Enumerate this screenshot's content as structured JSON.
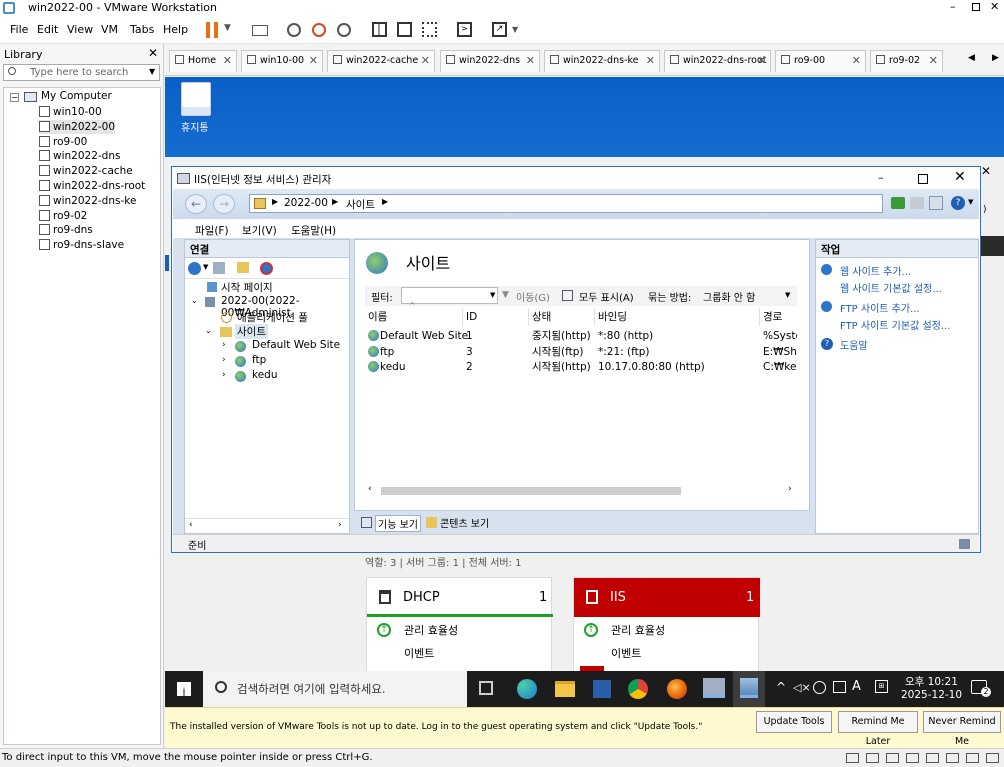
{
  "app": {
    "title": "win2022-00 - VMware Workstation"
  },
  "menu": [
    "File",
    "Edit",
    "View",
    "VM",
    "Tabs",
    "Help"
  ],
  "library": {
    "title": "Library",
    "search_placeholder": "Type here to search",
    "root": "My Computer",
    "items": [
      "win10-00",
      "win2022-00",
      "ro9-00",
      "win2022-dns",
      "win2022-cache",
      "win2022-dns-root",
      "win2022-dns-ke",
      "ro9-02",
      "ro9-dns",
      "ro9-dns-slave"
    ],
    "selected": 1
  },
  "tabs": [
    "Home",
    "win10-00",
    "win2022-cache",
    "win2022-dns",
    "win2022-dns-ke",
    "win2022-dns-root",
    "ro9-00",
    "ro9-02"
  ],
  "desktop": {
    "recycle_label": "휴지통"
  },
  "iis": {
    "title": "IIS(인터넷 정보 서비스) 관리자",
    "address": [
      "2022-00",
      "사이트"
    ],
    "menu": [
      "파일(F)",
      "보기(V)",
      "도움말(H)"
    ],
    "connections": {
      "title": "연결",
      "start": "시작 페이지",
      "server": "2022-00(2022-00₩Administ",
      "apppool": "애플리케이션 풀",
      "sites": "사이트",
      "children": [
        "Default Web Site",
        "ftp",
        "kedu"
      ]
    },
    "center": {
      "heading": "사이트",
      "filter_label": "필터:",
      "go_label": "이동(G)",
      "showall_label": "모두 표시(A)",
      "group_label": "묶는 방법:",
      "group_value": "그룹화 안 함",
      "columns": [
        "이름",
        "ID",
        "상태",
        "바인딩",
        "경로"
      ],
      "rows": [
        {
          "name": "Default Web Site",
          "id": "1",
          "status": "중지됨(http)",
          "binding": "*:80 (http)",
          "path": "%Syster"
        },
        {
          "name": "ftp",
          "id": "3",
          "status": "시작됨(ftp)",
          "binding": "*:21: (ftp)",
          "path": "E:₩Shar"
        },
        {
          "name": "kedu",
          "id": "2",
          "status": "시작됨(http)",
          "binding": "10.17.0.80:80 (http)",
          "path": "C:₩kedu"
        }
      ],
      "feature_view": "기능 보기",
      "content_view": "콘텐츠 보기"
    },
    "actions": {
      "title": "작업",
      "items": [
        "웹 사이트 추가...",
        "웹 사이트 기본값 설정...",
        "FTP 사이트 추가...",
        "FTP 사이트 기본값 설정...",
        "도움말"
      ]
    },
    "status": "준비"
  },
  "server_manager": {
    "summary": "역할: 3 | 서버 그룹: 1 | 전체 서버: 1",
    "cards": [
      {
        "name": "DHCP",
        "count": "1",
        "items": [
          "관리 효율성",
          "이벤트"
        ]
      },
      {
        "name": "IIS",
        "count": "1",
        "items": [
          "관리 효율성",
          "이벤트"
        ]
      }
    ]
  },
  "taskbar": {
    "search_placeholder": "검색하려면 여기에 입력하세요.",
    "time": "오후 10:21",
    "date": "2025-12-10",
    "notif": "2",
    "ime": "A"
  },
  "notice": {
    "text": "The installed version of VMware Tools is not up to date. Log in to the guest operating system and click \"Update Tools.\"",
    "buttons": [
      "Update Tools",
      "Remind Me Later",
      "Never Remind Me"
    ]
  },
  "statusbar": {
    "text": "To direct input to this VM, move the mouse pointer inside or press Ctrl+G."
  },
  "colors": {
    "accent": "#0a5fc6",
    "iis_red": "#c00000",
    "taskbar": "#1c1c1c"
  }
}
